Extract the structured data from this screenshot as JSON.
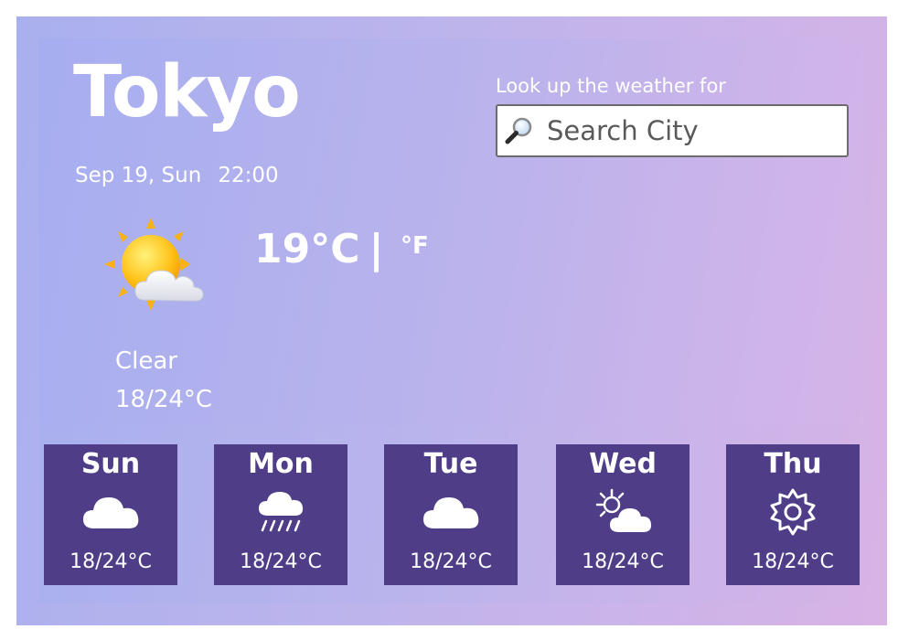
{
  "city": "Tokyo",
  "date": "Sep 19, Sun",
  "time": "22:00",
  "search": {
    "label": "Look up the weather for",
    "placeholder": "Search City",
    "icon": "magnifier-icon"
  },
  "current": {
    "icon": "sun-behind-cloud-icon",
    "temperature": "19°C",
    "separator": "|",
    "alt_unit": "°F",
    "condition": "Clear",
    "range": "18/24°C"
  },
  "forecast": [
    {
      "day": "Sun",
      "icon": "cloud-icon",
      "range": "18/24°C"
    },
    {
      "day": "Mon",
      "icon": "rain-icon",
      "range": "18/24°C"
    },
    {
      "day": "Tue",
      "icon": "cloud-icon",
      "range": "18/24°C"
    },
    {
      "day": "Wed",
      "icon": "partly-cloudy-icon",
      "range": "18/24°C"
    },
    {
      "day": "Thu",
      "icon": "sun-outline-icon",
      "range": "18/24°C"
    }
  ],
  "colors": {
    "forecast_card": "#4f3d88",
    "text": "#ffffff",
    "gradient_start": "#a9b0ee",
    "gradient_end": "#d8b3e6"
  }
}
